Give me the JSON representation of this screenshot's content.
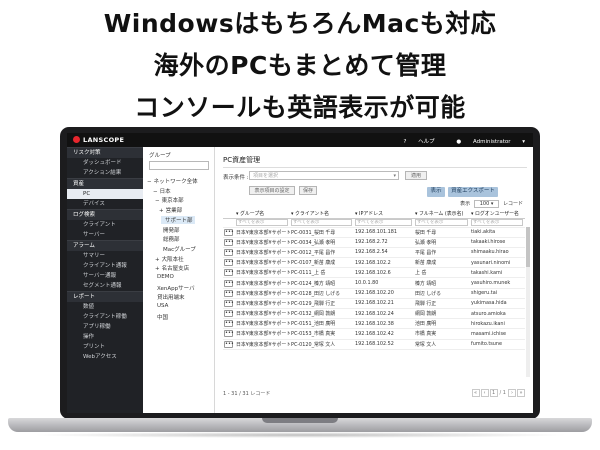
{
  "headline": {
    "line1": "WindowsはもちろんMacも対応",
    "line2": "海外のPCもまとめて管理",
    "line3": "コンソールも英語表示が可能"
  },
  "app": {
    "logo_text": "LANSCOPE",
    "help_label": "ヘルプ",
    "user_label": "Administrator",
    "brand_color": "#e8262d"
  },
  "nav": {
    "sections": [
      {
        "label": "リスク対策",
        "items": [
          {
            "label": "ダッシュボード"
          },
          {
            "label": "アクション結果"
          }
        ]
      },
      {
        "label": "資産",
        "items": [
          {
            "label": "PC",
            "active": true
          },
          {
            "label": "デバイス"
          }
        ]
      },
      {
        "label": "ログ検索",
        "items": [
          {
            "label": "クライアント"
          },
          {
            "label": "サーバー"
          }
        ]
      },
      {
        "label": "アラーム",
        "items": [
          {
            "label": "サマリー"
          },
          {
            "label": "クライアント通報"
          },
          {
            "label": "サーバー通報"
          },
          {
            "label": "セグメント通報"
          }
        ]
      },
      {
        "label": "レポート",
        "items": [
          {
            "label": "数値"
          },
          {
            "label": "クライアント稼働"
          },
          {
            "label": "アプリ稼働"
          },
          {
            "label": "操作"
          },
          {
            "label": "プリント"
          },
          {
            "label": "Webアクセス"
          }
        ]
      }
    ]
  },
  "tree": {
    "title": "グループ",
    "nodes": [
      {
        "label": "ネットワーク全体",
        "prefix": "−"
      },
      {
        "label": "日本",
        "prefix": "−"
      },
      {
        "label": "東京本部",
        "prefix": "−"
      },
      {
        "label": "営業部",
        "prefix": "+"
      },
      {
        "label": "サポート部",
        "prefix": "",
        "selected": true
      },
      {
        "label": "開発部",
        "prefix": ""
      },
      {
        "label": "総務部",
        "prefix": ""
      },
      {
        "label": "Macグループ",
        "prefix": ""
      },
      {
        "label": "大阪本社",
        "prefix": "+"
      },
      {
        "label": "名古屋支店",
        "prefix": "+"
      },
      {
        "label": "DEMO",
        "prefix": ""
      },
      {
        "label": "XenAppサーバ",
        "prefix": ""
      },
      {
        "label": "貸出用端末",
        "prefix": ""
      },
      {
        "label": "USA",
        "prefix": ""
      },
      {
        "label": "中国",
        "prefix": ""
      }
    ]
  },
  "main": {
    "title": "PC資産管理",
    "condition_label": "表示条件 :",
    "condition_placeholder": "項目を選択",
    "condition_button": "適用",
    "show_items_button": "表示項目の設定",
    "save_button": "保存",
    "display_button": "表示",
    "export_button": "資産エクスポート",
    "count_prefix": "表示",
    "count_value": "100",
    "count_suffix": "レコード",
    "columns": [
      "",
      "グループ名",
      "クライアント名",
      "IPアドレス",
      "フルネーム (表示名)",
      "ログオンユーザー名"
    ],
    "filter_placeholder": "すべてを表示",
    "rows": [
      [
        "日本¥東京本部¥サポート部",
        "PC-0031_桜田 千尋",
        "192.168.101.181",
        "桜田 千尋",
        "tiaki.akita"
      ],
      [
        "日本¥東京本部¥サポート部",
        "PC-0034_弘瀬 孝明",
        "192.168.2.72",
        "弘瀬 孝明",
        "takaaki.hirose"
      ],
      [
        "日本¥東京本部¥サポート部",
        "PC-0012_平尾 昌作",
        "192.168.2.54",
        "平尾 昌作",
        "shimaaku.hirao"
      ],
      [
        "日本¥東京本部¥サポート部",
        "PC-0107_新苗 康成",
        "192.168.102.2",
        "新苗 康成",
        "yasunari.ninomi"
      ],
      [
        "日本¥東京本部¥サポート部",
        "PC-0111_上 岳",
        "192.168.102.6",
        "上 岳",
        "takashi.kami"
      ],
      [
        "日本¥東京本部¥サポート部",
        "PC-0124_榛方 靖昭",
        "10.0.1.80",
        "榛方 靖昭",
        "yasuhiro.munek"
      ],
      [
        "日本¥東京本部¥サポート部",
        "PC-0128_田辺 しげる",
        "192.168.102.20",
        "田辺 しげる",
        "shigeru.tai"
      ],
      [
        "日本¥東京本部¥サポート部",
        "PC-0129_飛騨 行正",
        "192.168.102.21",
        "飛騨 行正",
        "yukimasa.hida"
      ],
      [
        "日本¥東京本部¥サポート部",
        "PC-0132_網岡 敦朗",
        "192.168.102.24",
        "網岡 敦朗",
        "atsuro.amioka"
      ],
      [
        "日本¥東京本部¥サポート部",
        "PC-0151_池田 廣明",
        "192.168.102.38",
        "池田 廣明",
        "hirokazu.ikani"
      ],
      [
        "日本¥東京本部¥サポート部",
        "PC-0153_市橋 真実",
        "192.168.102.42",
        "市橋 真実",
        "masami.ichise"
      ],
      [
        "日本¥東京本部¥サポート部",
        "PC-0120_常塚 文人",
        "192.168.102.52",
        "常塚 文人",
        "fumito.tsune"
      ]
    ],
    "records_label": "1 - 31 / 31 レコード",
    "page_current": "1",
    "page_total": "/ 1"
  }
}
